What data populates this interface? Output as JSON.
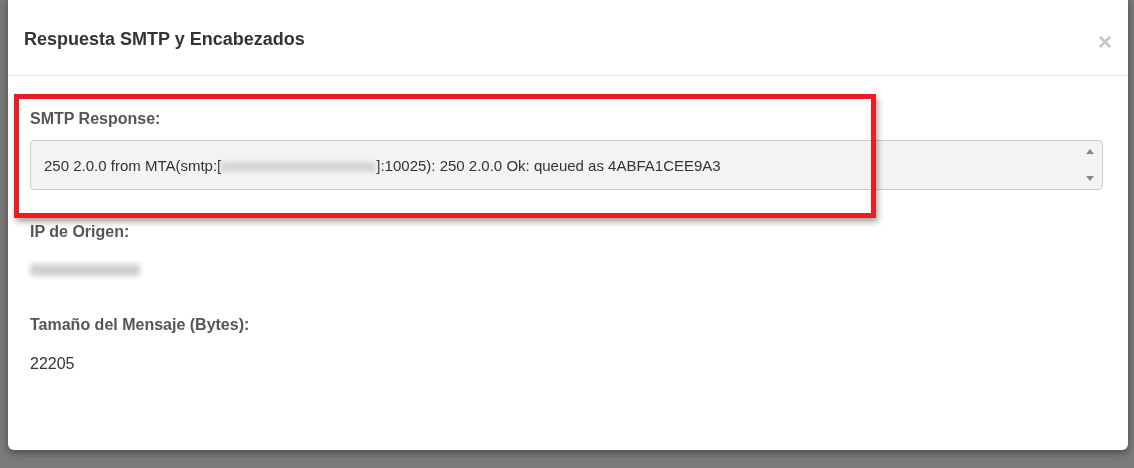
{
  "modal": {
    "title": "Respuesta SMTP y Encabezados",
    "close": "×",
    "fields": [
      {
        "label": "SMTP Response:",
        "kind": "textarea",
        "highlighted": true,
        "value_before": "250 2.0.0 from MTA(smtp:[",
        "value_after": "]:10025): 250 2.0.0 Ok: queued as 4ABFA1CEE9A3"
      },
      {
        "label": "IP de Origen:",
        "kind": "redacted",
        "highlighted": false
      },
      {
        "label": "Tamaño del Mensaje (Bytes):",
        "kind": "text",
        "highlighted": false,
        "value": "22205"
      }
    ]
  }
}
